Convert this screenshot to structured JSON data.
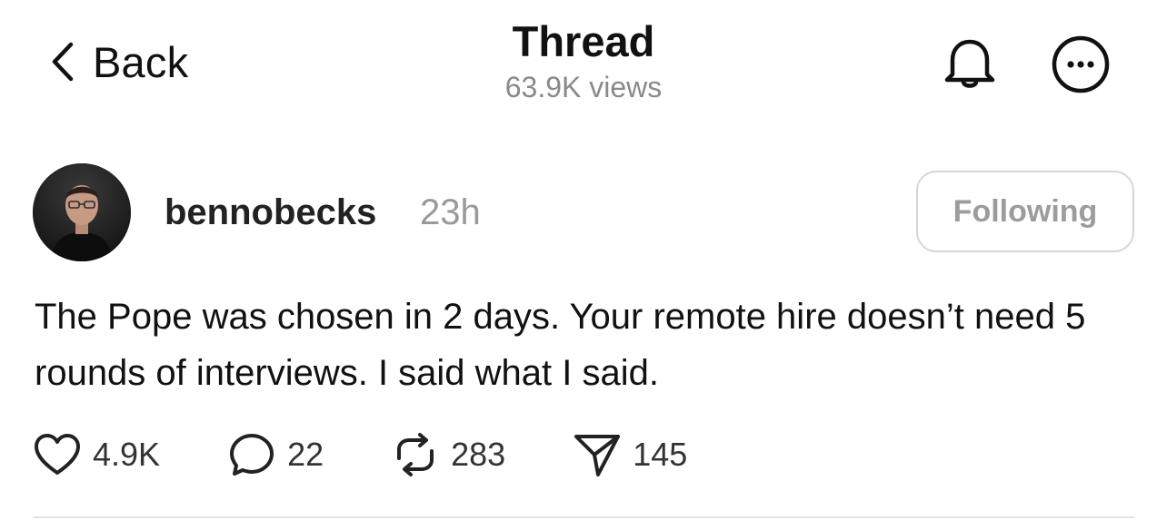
{
  "header": {
    "back_label": "Back",
    "title": "Thread",
    "views": "63.9K views",
    "bell_icon": "bell-icon",
    "more_icon": "more-options-icon"
  },
  "post": {
    "author": "bennobecks",
    "time": "23h",
    "follow_label": "Following",
    "text": "The Pope was chosen in 2 days. Your remote hire doesn’t need 5 rounds of interviews. I said what I said.",
    "actions": {
      "likes": "4.9K",
      "replies": "22",
      "reposts": "283",
      "shares": "145"
    }
  }
}
